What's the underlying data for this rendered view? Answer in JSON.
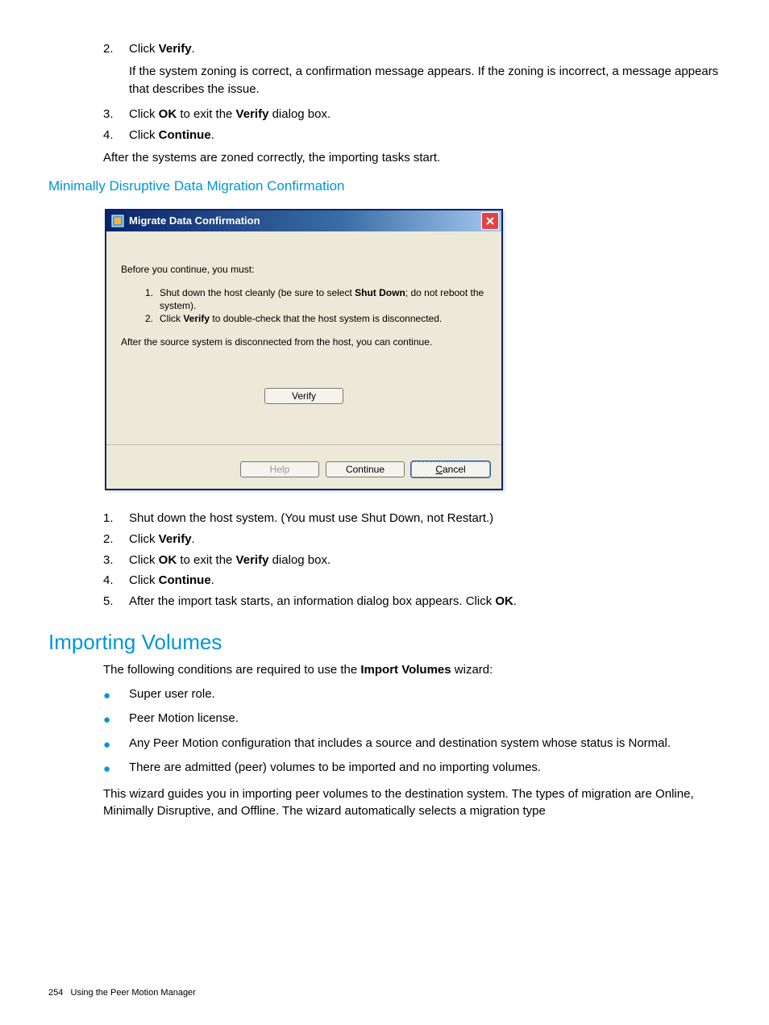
{
  "steps_a": {
    "s2_num": "2.",
    "s2_prefix": "Click ",
    "s2_bold": "Verify",
    "s2_suffix": ".",
    "s2_sub": "If the system zoning is correct, a confirmation message appears. If the zoning is incorrect, a message appears that describes the issue.",
    "s3_num": "3.",
    "s3_prefix": "Click ",
    "s3_b1": "OK",
    "s3_mid": " to exit the ",
    "s3_b2": "Verify",
    "s3_suffix": " dialog box.",
    "s4_num": "4.",
    "s4_prefix": "Click ",
    "s4_bold": "Continue",
    "s4_suffix": ".",
    "after": "After the systems are zoned correctly, the importing tasks start."
  },
  "h3": "Minimally Disruptive Data Migration Confirmation",
  "dialog": {
    "title": "Migrate Data Confirmation",
    "intro": "Before you continue, you must:",
    "d1_num": "1.",
    "d1_pre": "Shut down the host cleanly (be sure to select ",
    "d1_b": "Shut Down",
    "d1_post": "; do not reboot the system).",
    "d2_num": "2.",
    "d2_pre": "Click ",
    "d2_b": "Verify",
    "d2_post": " to double-check that the host system is disconnected.",
    "after": "After the source system is disconnected from the host, you can continue.",
    "verify_btn": "Verify",
    "help_btn": "Help",
    "continue_btn": "Continue",
    "cancel_btn": "Cancel"
  },
  "steps_b": {
    "s1_num": "1.",
    "s1_txt": "Shut down the host system. (You must use Shut Down, not Restart.)",
    "s2_num": "2.",
    "s2_prefix": "Click ",
    "s2_bold": "Verify",
    "s2_suffix": ".",
    "s3_num": "3.",
    "s3_prefix": "Click ",
    "s3_b1": "OK",
    "s3_mid": " to exit the ",
    "s3_b2": "Verify",
    "s3_suffix": " dialog box.",
    "s4_num": "4.",
    "s4_prefix": "Click ",
    "s4_bold": "Continue",
    "s4_suffix": ".",
    "s5_num": "5.",
    "s5_pre": "After the import task starts, an information dialog box appears. Click ",
    "s5_b": "OK",
    "s5_post": "."
  },
  "h2": "Importing Volumes",
  "iv": {
    "intro_pre": "The following conditions are required to use the ",
    "intro_b": "Import Volumes",
    "intro_post": " wizard:",
    "b1": "Super user role.",
    "b2": "Peer Motion license.",
    "b3": "Any Peer Motion configuration that includes a source and destination system whose status is Normal.",
    "b4": "There are admitted (peer) volumes to be imported and no importing volumes.",
    "closing": "This wizard guides you in importing peer volumes to the destination system. The types of migration are Online, Minimally Disruptive, and Offline. The wizard automatically selects a migration type"
  },
  "footer": {
    "page": "254",
    "title": "Using the Peer Motion Manager"
  }
}
